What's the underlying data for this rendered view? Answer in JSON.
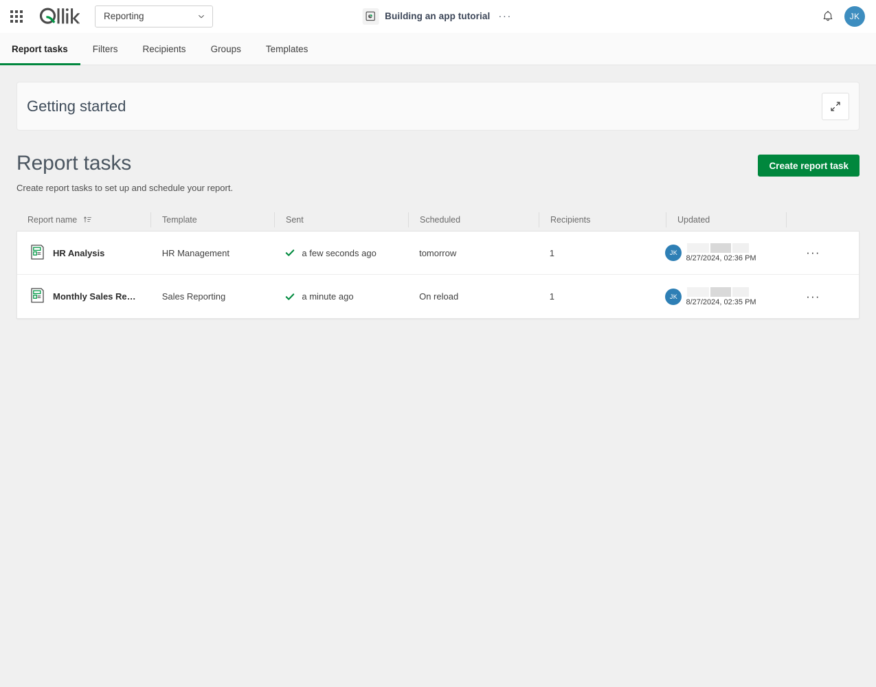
{
  "topbar": {
    "waffle_icon": "grid-apps-icon",
    "logo_text": "Qlik",
    "space_selector": {
      "value": "Reporting",
      "chevron_icon": "chevron-down-icon"
    },
    "app": {
      "icon": "app-chart-icon",
      "name": "Building an app tutorial",
      "more_label": "···"
    },
    "notifications_icon": "bell-icon",
    "avatar_initials": "JK"
  },
  "tabs": [
    {
      "label": "Report tasks",
      "active": true
    },
    {
      "label": "Filters",
      "active": false
    },
    {
      "label": "Recipients",
      "active": false
    },
    {
      "label": "Groups",
      "active": false
    },
    {
      "label": "Templates",
      "active": false
    }
  ],
  "getting_started": {
    "title": "Getting started",
    "expand_icon": "expand-arrows-icon"
  },
  "page": {
    "title": "Report tasks",
    "subtitle": "Create report tasks to set up and schedule your report.",
    "create_button": "Create report task"
  },
  "table": {
    "columns": [
      {
        "key": "name",
        "label": "Report name",
        "sort_icon": "sort-ascending-icon"
      },
      {
        "key": "template",
        "label": "Template"
      },
      {
        "key": "sent",
        "label": "Sent"
      },
      {
        "key": "scheduled",
        "label": "Scheduled"
      },
      {
        "key": "recipients",
        "label": "Recipients"
      },
      {
        "key": "updated",
        "label": "Updated"
      },
      {
        "key": "actions",
        "label": ""
      }
    ],
    "rows": [
      {
        "icon": "report-document-icon",
        "name": "HR Analysis",
        "template": "HR Management",
        "sent_status_icon": "check-icon",
        "sent": "a few seconds ago",
        "scheduled": "tomorrow",
        "recipients": "1",
        "updated_by_initials": "JK",
        "updated_at": "8/27/2024, 02:36 PM",
        "menu_label": "···"
      },
      {
        "icon": "report-document-icon",
        "name": "Monthly Sales Rep…",
        "template": "Sales Reporting",
        "sent_status_icon": "check-icon",
        "sent": "a minute ago",
        "scheduled": "On reload",
        "recipients": "1",
        "updated_by_initials": "JK",
        "updated_at": "8/27/2024, 02:35 PM",
        "menu_label": "···"
      }
    ]
  },
  "colors": {
    "brand_green": "#00873d",
    "accent_blue": "#2e7fb5",
    "page_bg": "#f0f0f0",
    "status_green": "#008a3e"
  }
}
